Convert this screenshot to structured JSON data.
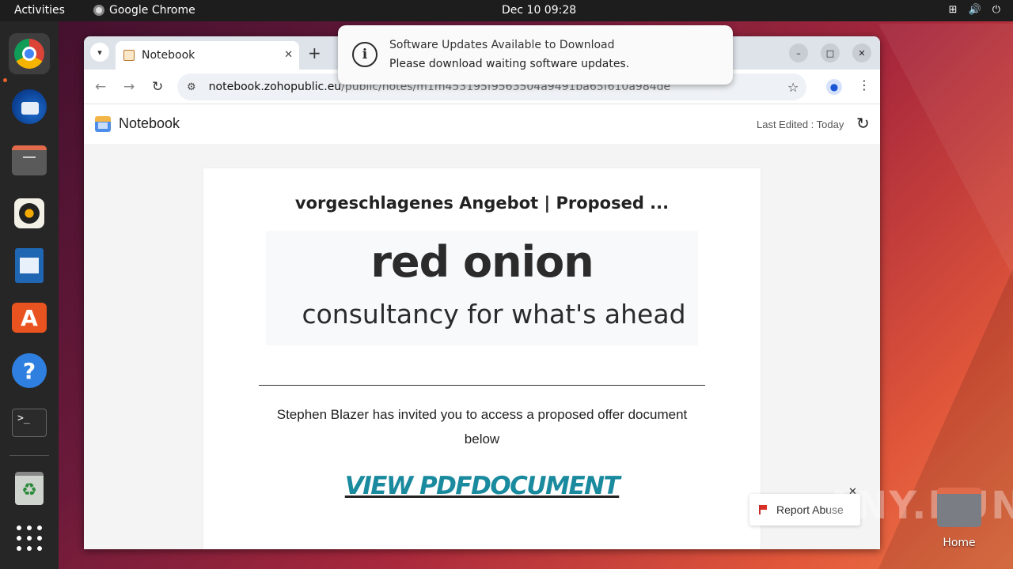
{
  "topbar": {
    "activities": "Activities",
    "app_name": "Google Chrome",
    "clock": "Dec 10  09:28"
  },
  "dock": {
    "items": [
      "chrome-icon",
      "thunderbird-icon",
      "files-icon",
      "rhythmbox-icon",
      "writer-icon",
      "app-center-icon",
      "help-icon",
      "terminal-icon",
      "trash-icon",
      "show-apps-icon"
    ],
    "terminal_glyph": ">_"
  },
  "browser": {
    "tab_title": "Notebook",
    "url_host": "notebook.zohopublic.eu",
    "url_path": "/public/notes/m1m453195f9563504a9491ba65f610a984de"
  },
  "notebook": {
    "app_title": "Notebook",
    "last_edited": "Last Edited : Today"
  },
  "note": {
    "title": "vorgeschlagenes Angebot | Proposed ...",
    "brand": "red onion",
    "tagline": "consultancy for what's ahead",
    "invite_text": "Stephen Blazer has invited you to access a proposed offer document below",
    "link_text": "VIEW PDFDOCUMENT"
  },
  "report": {
    "label": "Report Abuse"
  },
  "notification": {
    "title": "Software Updates Available to Download",
    "body": "Please download waiting software updates."
  },
  "desktop": {
    "home_label": "Home",
    "watermark": "ANY.RUN"
  },
  "colors": {
    "link": "#1a8a9e",
    "accent": "#e9531f"
  }
}
